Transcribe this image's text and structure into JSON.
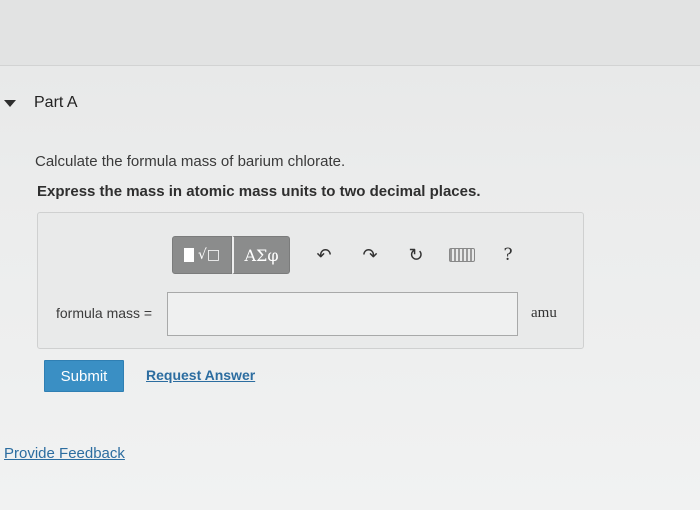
{
  "part": {
    "title": "Part A"
  },
  "question": {
    "text": "Calculate the formula mass of barium chlorate.",
    "instruction": "Express the mass in atomic mass units to two decimal places."
  },
  "toolbar": {
    "templates_label": "√□",
    "greek_label": "ΑΣφ",
    "undo_glyph": "↶",
    "redo_glyph": "↷",
    "reset_glyph": "↻",
    "help_label": "?"
  },
  "answer": {
    "label": "formula mass =",
    "value": "",
    "placeholder": "",
    "unit": "amu"
  },
  "actions": {
    "submit_label": "Submit",
    "request_answer_label": "Request Answer"
  },
  "footer": {
    "feedback_label": "Provide Feedback"
  }
}
